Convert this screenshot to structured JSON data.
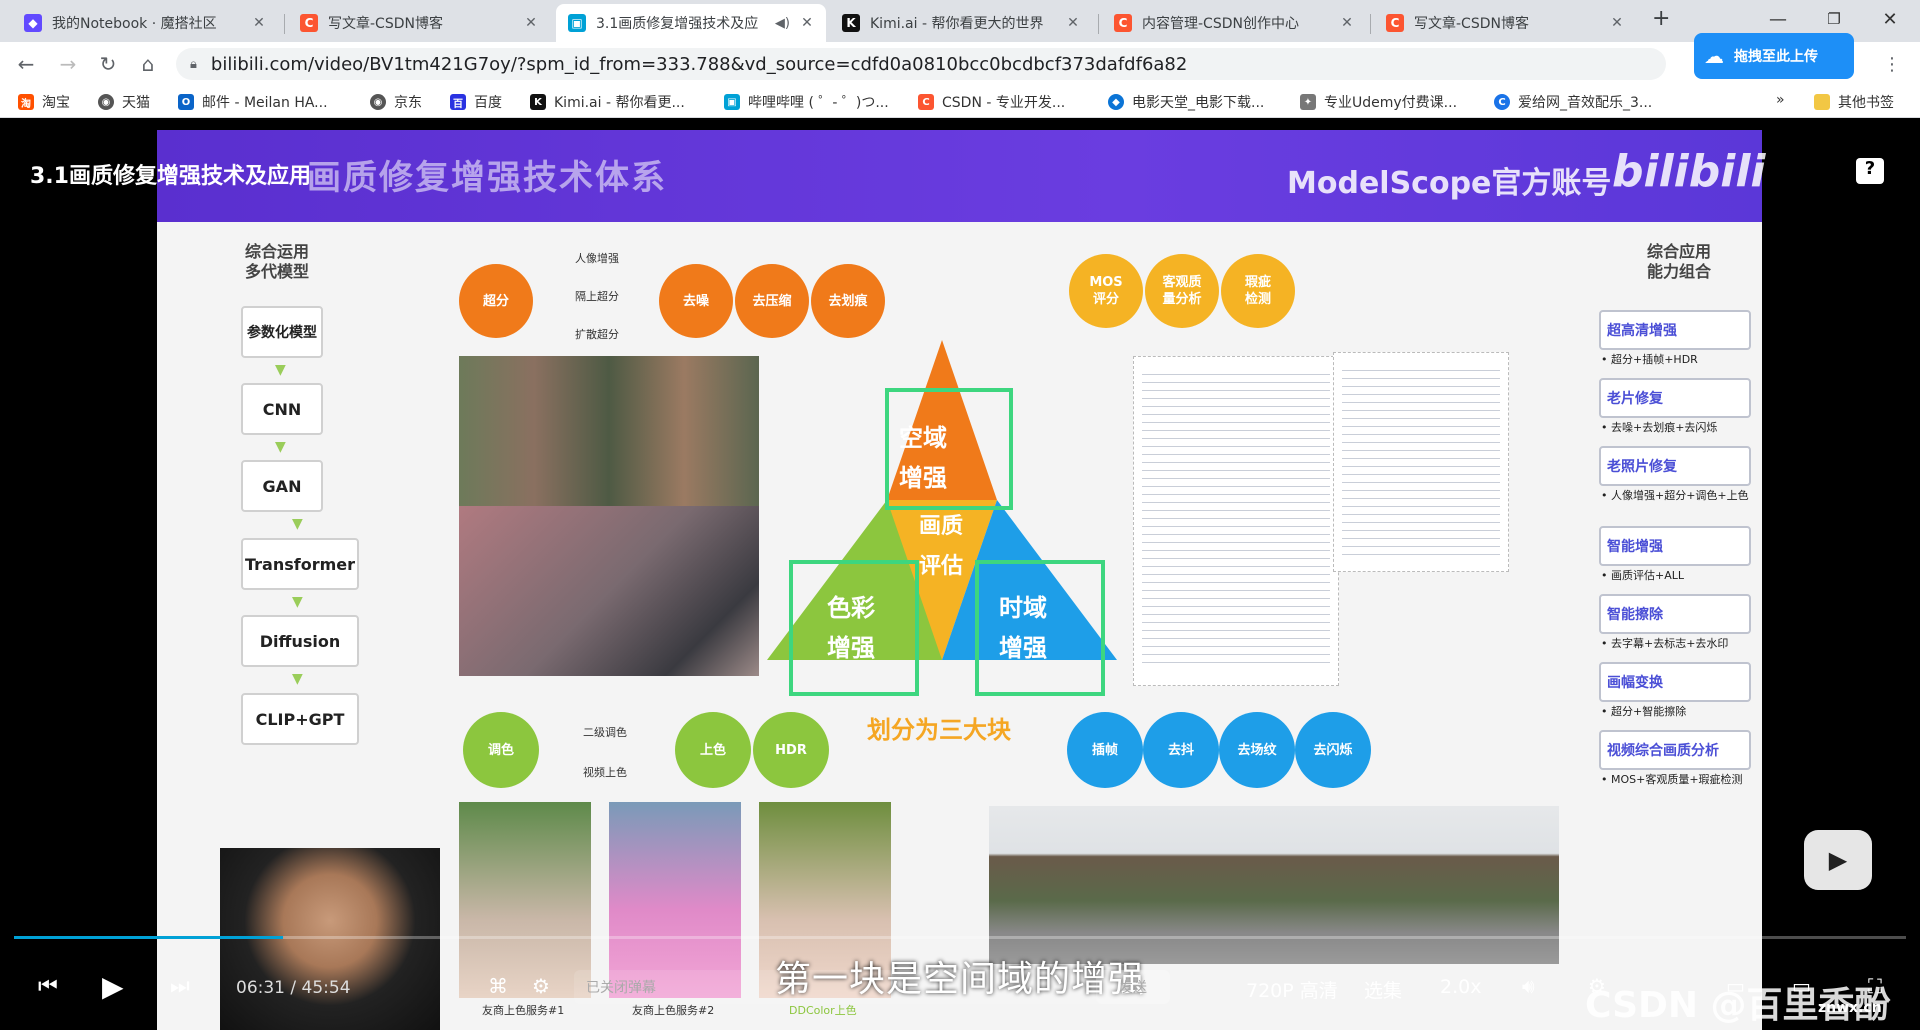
{
  "browser": {
    "tabs": [
      {
        "label": "我的Notebook · 魔搭社区",
        "icon": "modelscope-icon",
        "color": "#624aff"
      },
      {
        "label": "写文章-CSDN博客",
        "icon": "csdn-icon",
        "color": "#fc5531"
      },
      {
        "label": "3.1画质修复增强技术及应",
        "icon": "bilibili-icon",
        "color": "#00a1d6"
      },
      {
        "label": "Kimi.ai - 帮你看更大的世界",
        "icon": "kimi-icon",
        "color": "#111111"
      },
      {
        "label": "内容管理-CSDN创作中心",
        "icon": "csdn-icon",
        "color": "#fc5531"
      },
      {
        "label": "写文章-CSDN博客",
        "icon": "csdn-icon",
        "color": "#fc5531"
      }
    ],
    "new_tab": "+",
    "url": "bilibili.com/video/BV1tm421G7oy/?spm_id_from=333.788&vd_source=cdfd0a0810bcc0bcdbcf373dafdf6a82",
    "cloud_upload_label": "拖拽至此上传",
    "bookmarks": [
      {
        "label": "淘宝",
        "color": "#ff5000"
      },
      {
        "label": "天猫",
        "color": "#555555"
      },
      {
        "label": "邮件 - Meilan HA...",
        "color": "#0a64c8"
      },
      {
        "label": "京东",
        "color": "#555555"
      },
      {
        "label": "百度",
        "color": "#2932e1"
      },
      {
        "label": "Kimi.ai - 帮你看更...",
        "color": "#111111"
      },
      {
        "label": "哔哩哔哩 ( ゜- ゜)つ...",
        "color": "#00a1d6"
      },
      {
        "label": "CSDN - 专业开发...",
        "color": "#fc5531"
      },
      {
        "label": "电影天堂_电影下载...",
        "color": "#0b74d6"
      },
      {
        "label": "专业Udemy付费课...",
        "color": "#777777"
      },
      {
        "label": "爱给网_音效配乐_3...",
        "color": "#1a73e8"
      }
    ],
    "bookmarks_more": "»",
    "other_bookmarks": "其他书签"
  },
  "video": {
    "title": "3.1画质修复增强技术及应用",
    "time_current": "06:31",
    "time_separator": "/",
    "time_total": "45:54",
    "progress_fraction": 0.142,
    "danmaku_placeholder": "已关闭弹幕",
    "send_label": "发送",
    "quality_label": "720P 高清",
    "episodes_label": "选集",
    "speed_label": "2.0x",
    "subtitle": "第一块是空间域的增强",
    "watermark": "CSDN @百里香酚兰",
    "site_mark": "znwx.cn"
  },
  "slide": {
    "header_title": "画质修复增强技术体系",
    "header_brand": "ModelScope官方账号",
    "header_logo": "bilibili",
    "left_title": "综合运用\n多代模型",
    "left_models": [
      "参数化模型",
      "CNN",
      "GAN",
      "Transformer",
      "Diffusion",
      "CLIP+GPT"
    ],
    "top_left_pills": [
      "超分",
      "去噪",
      "去压缩",
      "去划痕"
    ],
    "top_left_branches": [
      "人像增强",
      "隔上超分",
      "扩散超分"
    ],
    "top_right_pills": [
      "MOS\n评分",
      "客观质\n量分析",
      "瑕疵\n检测"
    ],
    "pyramid": {
      "top": "空域\n增强",
      "center": "画质\n评估",
      "left": "色彩\n增强",
      "right": "时域\n增强"
    },
    "pyramid_caption": "划分为三大块",
    "color_pills": [
      "调色",
      "上色",
      "HDR"
    ],
    "color_branches": [
      "二级调色",
      "视频上色"
    ],
    "time_pills": [
      "插帧",
      "去抖",
      "去场纹",
      "去闪烁"
    ],
    "bottom_photo_labels": [
      "友商上色服务#1",
      "友商上色服务#2",
      "DDColor上色"
    ],
    "right_title": "综合应用\n能力组合",
    "right_items": [
      {
        "label": "超高清增强",
        "note": "• 超分+插帧+HDR"
      },
      {
        "label": "老片修复",
        "note": "• 去噪+去划痕+去闪烁"
      },
      {
        "label": "老照片修复",
        "note": "• 人像增强+超分+调色+上色"
      },
      {
        "label": "智能增强",
        "note": "• 画质评估+ALL"
      },
      {
        "label": "智能擦除",
        "note": "• 去字幕+去标志+去水印"
      },
      {
        "label": "画幅变换",
        "note": "• 超分+智能擦除"
      },
      {
        "label": "视频综合画质分析",
        "note": "• MOS+客观质量+瑕疵检测"
      }
    ]
  },
  "colors": {
    "orange": "#f07a1a",
    "yellow": "#f5b324",
    "green": "#8cc63e",
    "blue": "#1e9ee8",
    "purple_header": "#5a2fcf",
    "bilibili_blue": "#00a1d6"
  }
}
